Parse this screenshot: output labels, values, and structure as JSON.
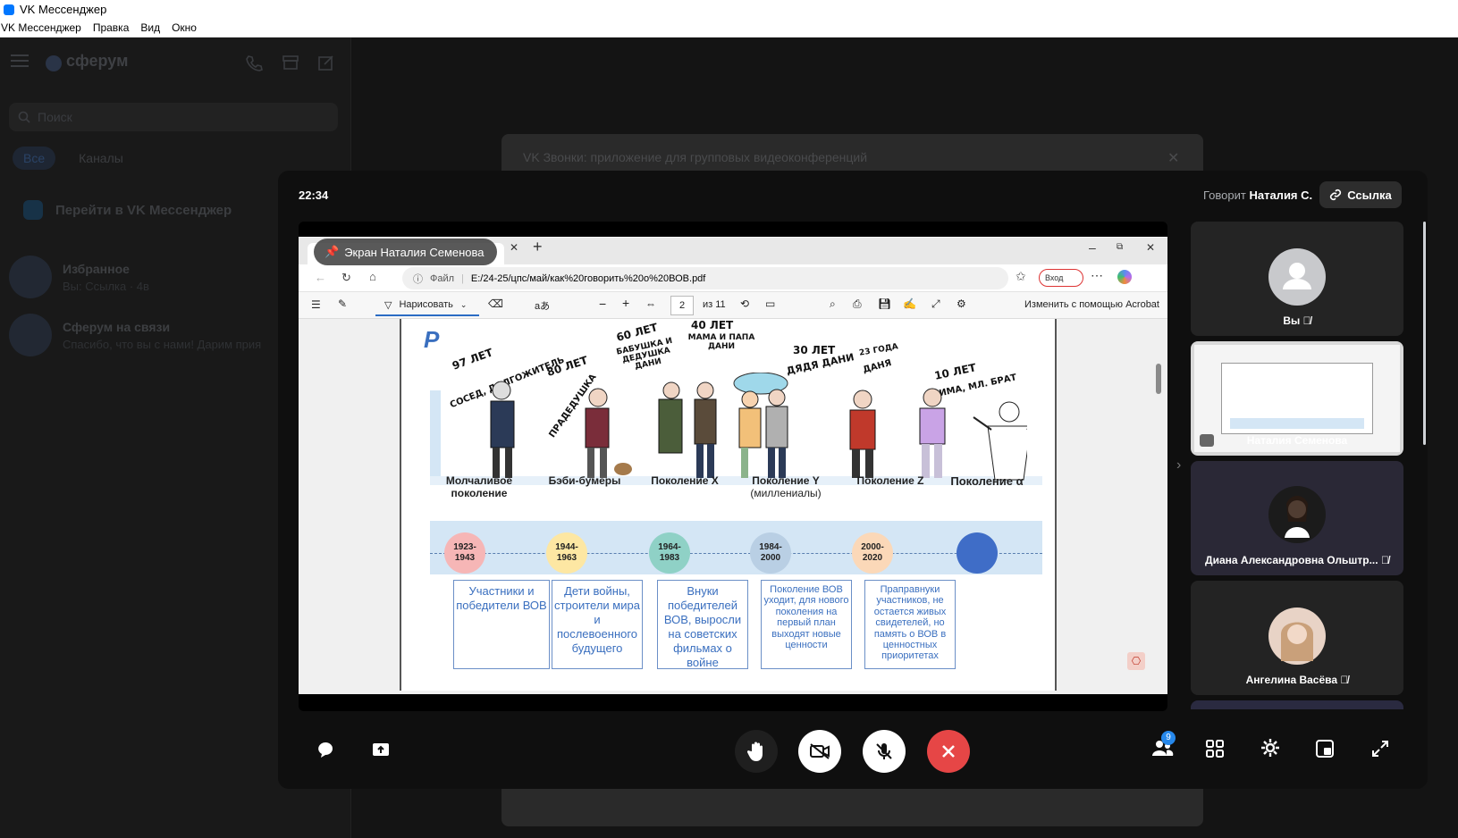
{
  "window": {
    "title": "VK Мессенджер"
  },
  "menu": [
    "VK Мессенджер",
    "Правка",
    "Вид",
    "Окно"
  ],
  "messenger": {
    "brand": "сферум",
    "search_placeholder": "Поиск",
    "tabs": [
      "Все",
      "Каналы"
    ],
    "goto": "Перейти в VK Мессенджер",
    "chats": [
      {
        "name": "Избранное",
        "preview": "Вы: Ссылка · 4в"
      },
      {
        "name": "Сферум на связи",
        "preview": "Спасибо, что вы с нами! Дарим прия"
      }
    ]
  },
  "dialog": {
    "title": "VK Звонки: приложение для групповых видеоконференций"
  },
  "call": {
    "clock": "22:34",
    "speaking_prefix": "Говорит",
    "speaking_name": "Наталия С.",
    "link_button": "Ссылка",
    "screen_label": "Экран Наталия Семенова",
    "participants": [
      {
        "name": "Вы"
      },
      {
        "name": "Наталия Семенова"
      },
      {
        "name": "Диана Александровна Ольштр..."
      },
      {
        "name": "Ангелина Васёва"
      }
    ],
    "participants_badge": "9"
  },
  "browser": {
    "address_prefix": "Файл",
    "address": "E:/24-25/цпс/май/как%20говорить%20о%20ВОВ.pdf",
    "login": "Вход",
    "draw_label": "Нарисовать",
    "page_current": "2",
    "page_total": "из 11",
    "acrobat": "Изменить с помощью Acrobat"
  },
  "pdf": {
    "letter": "Р",
    "ages": [
      "97 ЛЕТ",
      "СОСЕД, ДОЛГОЖИТЕЛЬ",
      "80 ЛЕТ",
      "ПРАДЕДУШКА",
      "60 ЛЕТ",
      "БАБУШКА И ДЕДУШКА ДАНИ",
      "40 ЛЕТ",
      "МАМА И ПАПА ДАНИ",
      "30 ЛЕТ",
      "ДЯДЯ ДАНИ",
      "23 ГОДА",
      "ДАНЯ",
      "10 ЛЕТ",
      "ТИМА, МЛ. БРАТ"
    ],
    "generations": [
      {
        "name": "Молчаливое поколение",
        "sub": ""
      },
      {
        "name": "Бэби-бумеры",
        "sub": ""
      },
      {
        "name": "Поколение X",
        "sub": ""
      },
      {
        "name": "Поколение Y",
        "sub": "(миллениалы)"
      },
      {
        "name": "Поколение Z",
        "sub": ""
      },
      {
        "name": "Поколение α",
        "sub": ""
      }
    ],
    "years": [
      "1923-1943",
      "1944-1963",
      "1964-1983",
      "1984-2000",
      "2000-2020"
    ],
    "descriptions": [
      "Участники и победители ВОВ",
      "Дети войны, строители мира и послевоенного будущего",
      "Внуки победителей ВОВ, выросли на советских фильмах о войне",
      "Поколение ВОВ уходит, для нового поколения на первый план выходят новые ценности",
      "Праправнуки участников, не остается живых свидетелей, но память о ВОВ в ценностных приоритетах"
    ],
    "colors": {
      "c1": "#f6b6b6",
      "c2": "#fde7a3",
      "c3": "#8fd1c6",
      "c4": "#b9cfe4",
      "c5": "#fbd8b8",
      "c6": "#3f6dc7",
      "band": "#d4e6f5"
    }
  }
}
